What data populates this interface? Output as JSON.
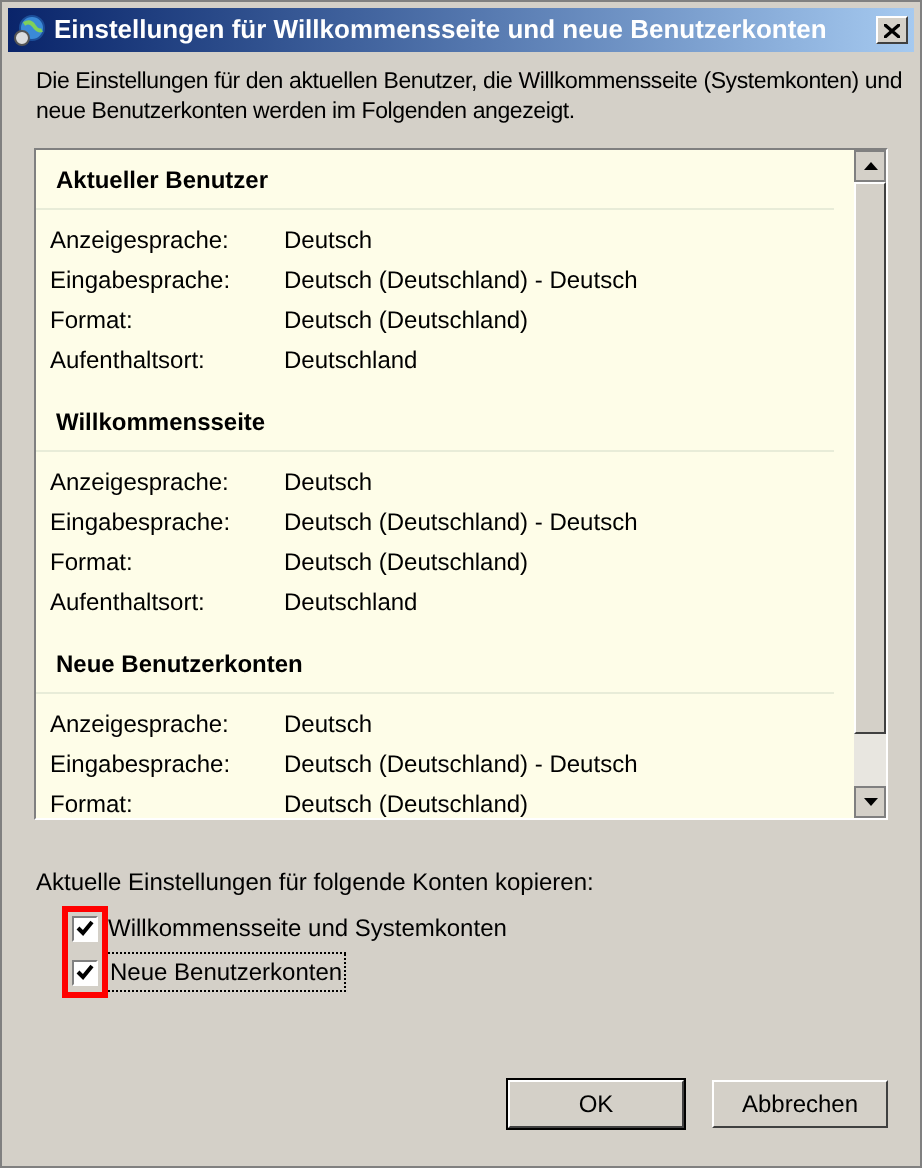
{
  "window": {
    "title": "Einstellungen für Willkommensseite und neue Benutzerkonten"
  },
  "intro": "Die Einstellungen für den aktuellen Benutzer, die Willkommensseite (Systemkonten) und neue Benutzerkonten werden im Folgenden angezeigt.",
  "sections": [
    {
      "title": "Aktueller Benutzer",
      "rows": [
        {
          "label": "Anzeigesprache:",
          "value": "Deutsch"
        },
        {
          "label": "Eingabesprache:",
          "value": "Deutsch (Deutschland) - Deutsch"
        },
        {
          "label": "Format:",
          "value": "Deutsch (Deutschland)"
        },
        {
          "label": "Aufenthaltsort:",
          "value": "Deutschland"
        }
      ]
    },
    {
      "title": "Willkommensseite",
      "rows": [
        {
          "label": "Anzeigesprache:",
          "value": "Deutsch"
        },
        {
          "label": "Eingabesprache:",
          "value": "Deutsch (Deutschland) - Deutsch"
        },
        {
          "label": "Format:",
          "value": "Deutsch (Deutschland)"
        },
        {
          "label": "Aufenthaltsort:",
          "value": "Deutschland"
        }
      ]
    },
    {
      "title": "Neue Benutzerkonten",
      "rows": [
        {
          "label": "Anzeigesprache:",
          "value": "Deutsch"
        },
        {
          "label": "Eingabesprache:",
          "value": "Deutsch (Deutschland) - Deutsch"
        },
        {
          "label": "Format:",
          "value": "Deutsch (Deutschland)"
        }
      ]
    }
  ],
  "copy_label": "Aktuelle Einstellungen für folgende Konten kopieren:",
  "checkboxes": [
    {
      "label": "Willkommensseite und Systemkonten",
      "checked": true
    },
    {
      "label": "Neue Benutzerkonten",
      "checked": true
    }
  ],
  "buttons": [
    {
      "label": "OK",
      "default": true
    },
    {
      "label": "Abbrechen",
      "default": false
    }
  ]
}
